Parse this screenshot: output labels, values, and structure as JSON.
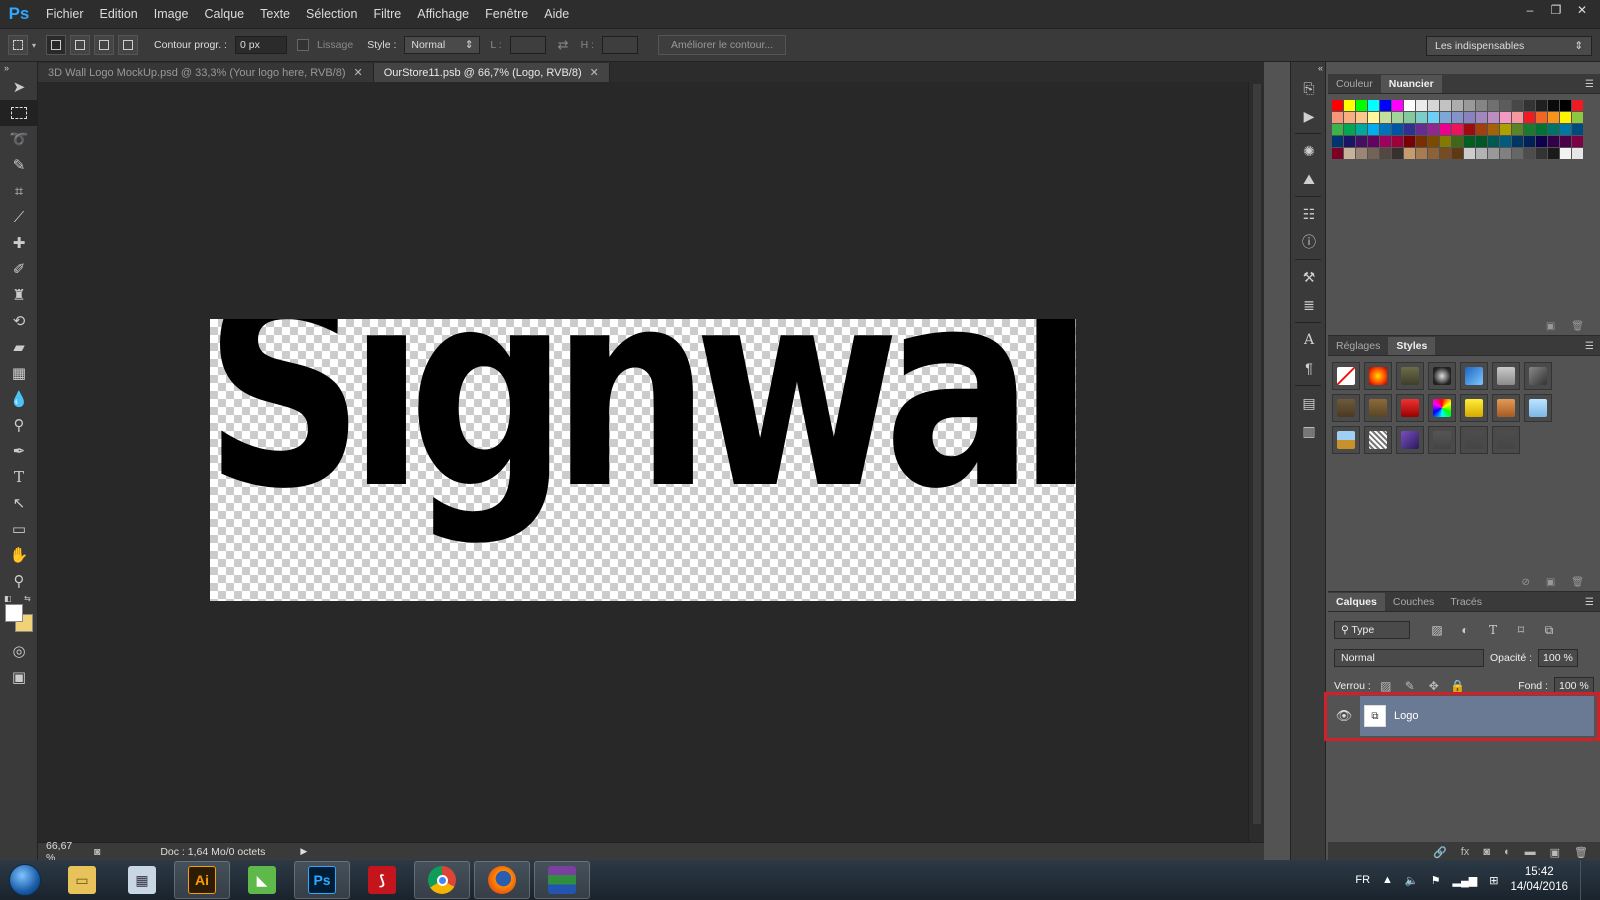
{
  "app": {
    "logo": "Ps"
  },
  "menu": [
    "Fichier",
    "Edition",
    "Image",
    "Calque",
    "Texte",
    "Sélection",
    "Filtre",
    "Affichage",
    "Fenêtre",
    "Aide"
  ],
  "window_controls": [
    "–",
    "❐",
    "✕"
  ],
  "options": {
    "contour_label": "Contour progr. :",
    "contour_value": "0 px",
    "lissage_label": "Lissage",
    "style_label": "Style :",
    "style_value": "Normal",
    "l_label": "L :",
    "h_label": "H :",
    "refine_button": "Améliorer le contour...",
    "workspace": "Les indispensables"
  },
  "tabs": [
    {
      "label": "3D Wall Logo MockUp.psd @ 33,3% (Your logo here, RVB/8)",
      "active": false
    },
    {
      "label": "OurStore11.psb @ 66,7% (Logo, RVB/8)",
      "active": true
    }
  ],
  "canvas": {
    "logo_text": "Signwall"
  },
  "status": {
    "zoom": "66,67 %",
    "doc": "Doc : 1,64 Mo/0 octets"
  },
  "swatches_panel": {
    "tabs": [
      "Couleur",
      "Nuancier"
    ],
    "active": "Nuancier"
  },
  "styles_panel": {
    "tabs": [
      "Réglages",
      "Styles"
    ],
    "active": "Styles"
  },
  "layers_panel": {
    "tabs": [
      "Calques",
      "Couches",
      "Tracés"
    ],
    "active": "Calques",
    "filter": "Type",
    "blend_mode": "Normal",
    "opacity_label": "Opacité :",
    "opacity_value": "100 %",
    "lock_label": "Verrou :",
    "fill_label": "Fond :",
    "fill_value": "100 %",
    "layers": [
      {
        "name": "Logo",
        "visible": true,
        "selected": true
      }
    ]
  },
  "taskbar": {
    "language": "FR",
    "time": "15:42",
    "date": "14/04/2016"
  },
  "colors": {
    "foreground": "#ffffff",
    "background": "#f2d277",
    "highlight": "#d2202a",
    "selected_layer": "#6a7a95"
  }
}
